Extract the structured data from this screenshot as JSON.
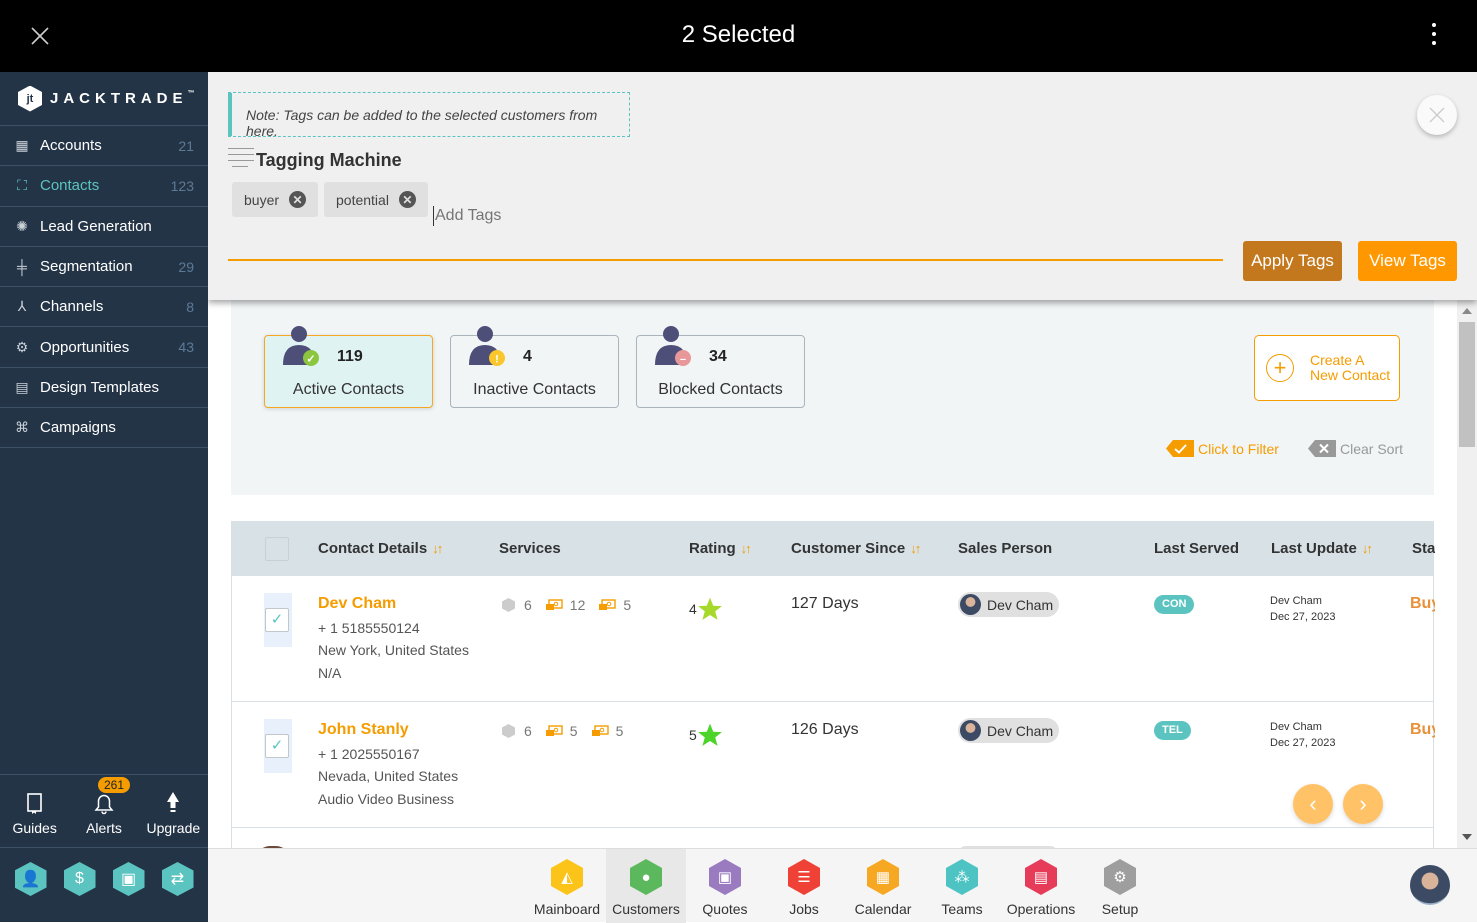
{
  "topbar": {
    "title": "2 Selected",
    "close_icon": "close-icon",
    "menu_icon": "kebab-menu-icon"
  },
  "brand": {
    "name": "JACKTRADE",
    "trademark": "™",
    "logo_glyph": "jt"
  },
  "sidebar": {
    "items": [
      {
        "label": "Accounts",
        "count": "21",
        "icon": "building-icon",
        "glyph": "▦",
        "active": false
      },
      {
        "label": "Contacts",
        "count": "123",
        "icon": "contacts-icon",
        "glyph": "⛶",
        "active": true
      },
      {
        "label": "Lead Generation",
        "count": "",
        "icon": "lead-generation-icon",
        "glyph": "✺",
        "active": false
      },
      {
        "label": "Segmentation",
        "count": "29",
        "icon": "segmentation-icon",
        "glyph": "╪",
        "active": false
      },
      {
        "label": "Channels",
        "count": "8",
        "icon": "channels-icon",
        "glyph": "⅄",
        "active": false
      },
      {
        "label": "Opportunities",
        "count": "43",
        "icon": "opportunities-icon",
        "glyph": "⚙",
        "active": false
      },
      {
        "label": "Design Templates",
        "count": "",
        "icon": "design-templates-icon",
        "glyph": "▤",
        "active": false
      },
      {
        "label": "Campaigns",
        "count": "",
        "icon": "campaigns-icon",
        "glyph": "⌘",
        "active": false
      }
    ],
    "quick": [
      {
        "label": "Guides",
        "icon": "book-icon"
      },
      {
        "label": "Alerts",
        "icon": "bell-icon",
        "badge": "261"
      },
      {
        "label": "Upgrade",
        "icon": "upgrade-arrow-icon"
      }
    ],
    "apps": [
      {
        "icon": "user-app-icon",
        "glyph": "👤"
      },
      {
        "icon": "dollar-app-icon",
        "glyph": "$"
      },
      {
        "icon": "billing-app-icon",
        "glyph": "▣"
      },
      {
        "icon": "workflow-app-icon",
        "glyph": "⇄"
      }
    ]
  },
  "tagging": {
    "note": "Note: Tags can be added to the selected customers from here.",
    "title": "Tagging Machine",
    "tags": [
      "buyer",
      "potential"
    ],
    "input_placeholder": "Add Tags",
    "input_value": "",
    "apply_label": "Apply Tags",
    "view_label": "View Tags",
    "accent": "#f59c00"
  },
  "stats": [
    {
      "count": "119",
      "label": "Active Contacts",
      "status": "active",
      "badge_color": "#8cc63f",
      "badge_glyph": "✓"
    },
    {
      "count": "4",
      "label": "Inactive Contacts",
      "status": "inactive",
      "badge_color": "#f9c62b",
      "badge_glyph": "!"
    },
    {
      "count": "34",
      "label": "Blocked Contacts",
      "status": "blocked",
      "badge_color": "#e89898",
      "badge_glyph": "–"
    }
  ],
  "create": {
    "line1": "Create A",
    "line2": "New Contact"
  },
  "filters": {
    "click_to_filter": "Click to Filter",
    "clear_sort": "Clear Sort"
  },
  "table": {
    "columns": [
      {
        "label": "Contact Details",
        "sortable": true
      },
      {
        "label": "Services",
        "sortable": false
      },
      {
        "label": "Rating",
        "sortable": true
      },
      {
        "label": "Customer Since",
        "sortable": true
      },
      {
        "label": "Sales Person",
        "sortable": false
      },
      {
        "label": "Last Served",
        "sortable": false
      },
      {
        "label": "Last Update",
        "sortable": true
      },
      {
        "label": "Status",
        "sortable": false
      }
    ],
    "rows": [
      {
        "selected": true,
        "name": "Dev Cham",
        "phone": "+ 1 5185550124",
        "location": "New York, United States",
        "business": "N/A",
        "services": {
          "a": "6",
          "b": "12",
          "c": "5"
        },
        "rating": "4",
        "star_color": "#a6d92b",
        "customer_since": "127 Days",
        "sales_person": "Dev Cham",
        "last_served": "CON",
        "last_update_by": "Dev Cham",
        "last_update_date": "Dec 27, 2023",
        "status": "Buyer"
      },
      {
        "selected": true,
        "name": "John Stanly",
        "phone": "+ 1 2025550167",
        "location": "Nevada, United States",
        "business": "Audio Video Business",
        "services": {
          "a": "6",
          "b": "5",
          "c": "5"
        },
        "rating": "5",
        "star_color": "#4cd42a",
        "customer_since": "126 Days",
        "sales_person": "Dev Cham",
        "last_served": "TEL",
        "last_update_by": "Dev Cham",
        "last_update_date": "Dec 27, 2023",
        "status": "Buyer"
      }
    ]
  },
  "pager": {
    "prev": "‹",
    "next": "›"
  },
  "bottom_tabs": [
    {
      "label": "Mainboard",
      "color": "#fcc419",
      "glyph": "◭",
      "icon": "mainboard-icon",
      "active": false
    },
    {
      "label": "Customers",
      "color": "#5cb85c",
      "glyph": "●",
      "icon": "customers-icon",
      "active": true
    },
    {
      "label": "Quotes",
      "color": "#9b7bbf",
      "glyph": "▣",
      "icon": "quotes-icon",
      "active": false
    },
    {
      "label": "Jobs",
      "color": "#ef4136",
      "glyph": "☰",
      "icon": "jobs-icon",
      "active": false
    },
    {
      "label": "Calendar",
      "color": "#f7a823",
      "glyph": "▦",
      "icon": "calendar-icon",
      "active": false
    },
    {
      "label": "Teams",
      "color": "#4dc3c3",
      "glyph": "⁂",
      "icon": "teams-icon",
      "active": false
    },
    {
      "label": "Operations",
      "color": "#e63c5a",
      "glyph": "▤",
      "icon": "operations-icon",
      "active": false
    },
    {
      "label": "Setup",
      "color": "#9e9e9e",
      "glyph": "⚙",
      "icon": "setup-icon",
      "active": false
    }
  ]
}
